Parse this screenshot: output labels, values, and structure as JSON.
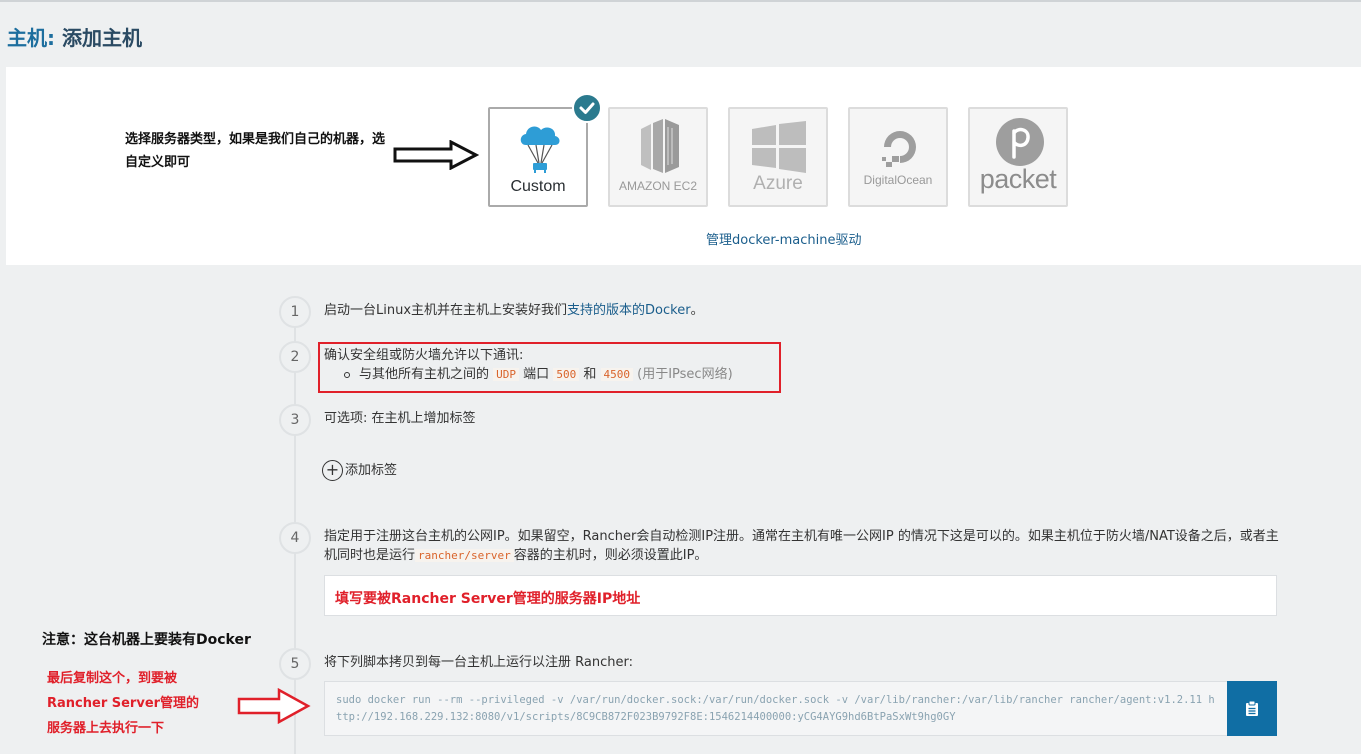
{
  "page": {
    "title_prefix": "主机:",
    "title_main": " 添加主机"
  },
  "annotations": {
    "select_type": "选择服务器类型，如果是我们自己的机器，选自定义即可",
    "docker_required": "注意：这台机器上要装有Docker",
    "copy_note_line1": "最后复制这个，到要被",
    "copy_note_line2": "Rancher Server管理的",
    "copy_note_line3": "服务器上去执行一下"
  },
  "drivers": [
    {
      "name": "custom",
      "label": "Custom",
      "selected": true,
      "icon": "cloud-parachute-icon"
    },
    {
      "name": "amazon-ec2",
      "label": "AMAZON EC2",
      "selected": false,
      "icon": "amazon-ec2-icon"
    },
    {
      "name": "azure",
      "label": "Azure",
      "selected": false,
      "icon": "windows-icon"
    },
    {
      "name": "digitalocean",
      "label": "DigitalOcean",
      "selected": false,
      "icon": "digitalocean-icon"
    },
    {
      "name": "packet",
      "label": "packet",
      "selected": false,
      "icon": "packet-icon"
    }
  ],
  "manage_link": "管理docker-machine驱动",
  "steps": {
    "s1": {
      "num": "1",
      "text_a": "启动一台Linux主机并在主机上安装好我们",
      "link": "支持的版本的Docker",
      "text_b": "。"
    },
    "s2": {
      "num": "2",
      "heading": "确认安全组或防火墙允许以下通讯:",
      "bullet_a": "与其他所有主机之间的",
      "proto": "UDP",
      "port_word": "端口",
      "port1": "500",
      "and_word": "和",
      "port2": "4500",
      "note": "(用于IPsec网络)"
    },
    "s3": {
      "num": "3",
      "text": "可选项: 在主机上增加标签",
      "add_label": "添加标签"
    },
    "s4": {
      "num": "4",
      "text_a": "指定用于注册这台主机的公网IP。如果留空，Rancher会自动检测IP注册。通常在主机有唯一公网IP 的情况下这是可以的。如果主机位于防火墙/NAT设备之后，或者主机同时也是运行",
      "code": "rancher/server",
      "text_b": "容器的主机时，则必须设置此IP。",
      "input_value": "填写要被Rancher Server管理的服务器IP地址"
    },
    "s5": {
      "num": "5",
      "text": "将下列脚本拷贝到每一台主机上运行以注册 Rancher:",
      "command": "sudo docker run --rm --privileged -v /var/run/docker.sock:/var/run/docker.sock -v /var/lib/rancher:/var/lib/rancher rancher/agent:v1.2.11 http://192.168.229.132:8080/v1/scripts/8C9CB872F023B9792F8E:1546214400000:yCG4AYG9hd6BtPaSxWt9hg0GY"
    }
  },
  "colors": {
    "accent": "#1d6e9e",
    "annotation_red": "#e0202a",
    "check_badge": "#2b7a8e",
    "copy_button": "#106ea4"
  }
}
